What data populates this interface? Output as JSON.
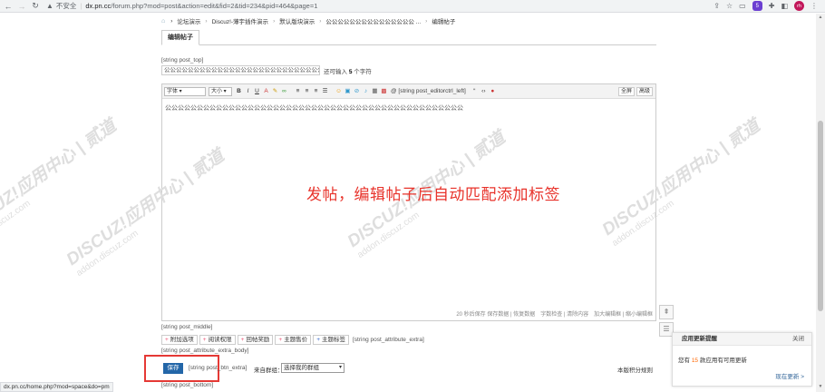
{
  "browser": {
    "insecure_label": "不安全",
    "url_host": "dx.pn.cc",
    "url_path": "/forum.php?mod=post&action=edit&fid=2&tid=234&pid=464&page=1",
    "profile_initials": "rh",
    "extension_badge": "5"
  },
  "breadcrumb": [
    "论坛演示",
    "Discuz!-薄宇插件演示",
    "默认版块演示",
    "公公公公公公公公公公公公公公公 ..."
  ],
  "breadcrumb_current": "编辑帖子",
  "tab_label": "编辑帖子",
  "hooks": {
    "post_top": "[string post_top]",
    "post_middle": "[string post_middle]",
    "attribute_extra_body": "[string post_attribute_extra_body]",
    "attribute_extra": "[string post_attribute_extra]",
    "btn_extra": "[string post_btn_extra]",
    "post_bottom": "[string post_bottom]",
    "editorctrl_left": "@ [string post_editorctrl_left]"
  },
  "subject": {
    "value": "公公公公公公公公公公公公公公公公公公公公公公公公公公公公",
    "hint_prefix": "还可输入",
    "hint_count": "5",
    "hint_suffix": "个字符"
  },
  "editor": {
    "font_select": "字体",
    "size_select": "大小",
    "fullscreen": "全屏",
    "advanced": "高级",
    "content": "公公公公公公公公公公公公公公公公公公公公公公公公公公公公公公公公公公公公公公公公公公公公公公公",
    "status": "20 秒后保存 保存数据 | 恢复数据　字数检查 | 清除内容　加大编辑框 | 缩小编辑框"
  },
  "overlay_caption": "发帖，编辑帖子后自动匹配添加标签",
  "watermark": {
    "brand": "DISCUZ!应用中心 | 贰道",
    "sub": "addon.discuz.com"
  },
  "attribute_tabs": [
    {
      "label": "附加选项",
      "color": "#e57"
    },
    {
      "label": "阅读权限",
      "color": "#e57"
    },
    {
      "label": "回帖奖励",
      "color": "#e57"
    },
    {
      "label": "主题售价",
      "color": "#e57"
    },
    {
      "label": "主题标签",
      "color": "#36c"
    }
  ],
  "save_label": "保存",
  "group_label": "来自群组：",
  "group_select": "选择我的群组",
  "credit_rule": "本版积分规则",
  "status_bar_url": "dx.pn.cc/home.php?mod=space&do=pm",
  "notice": {
    "title": "应用更新提醒",
    "close": "关闭",
    "body_prefix": "您有",
    "count": "15",
    "body_suffix": "款应用有可用更新",
    "link": "现在更新 >"
  }
}
